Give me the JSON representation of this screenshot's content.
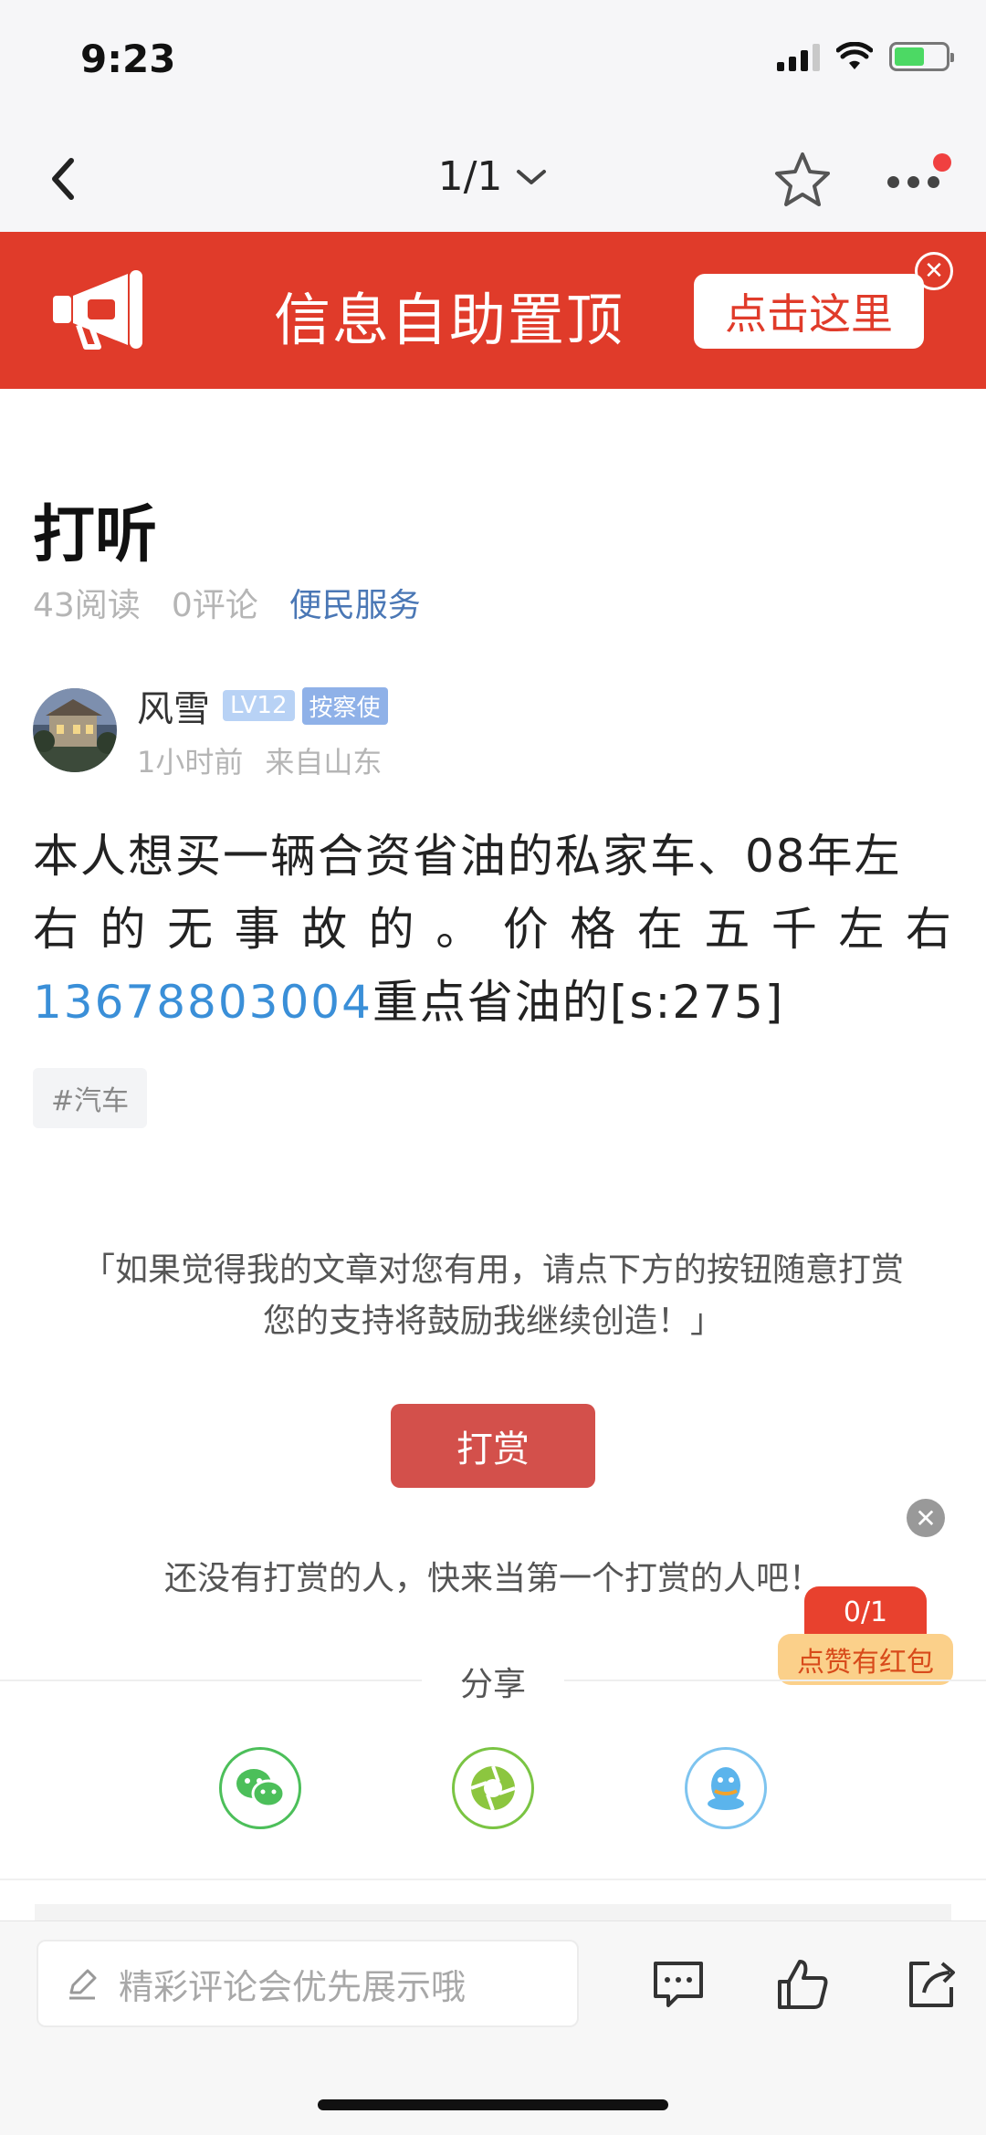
{
  "status_bar": {
    "time": "9:23"
  },
  "nav": {
    "page_indicator": "1/1"
  },
  "banner": {
    "text": "信息自助置顶",
    "button_label": "点击这里",
    "close_symbol": "✕"
  },
  "article": {
    "title": "打听",
    "reads": "43阅读",
    "comments": "0评论",
    "category": "便民服务",
    "author": {
      "name": "风雪",
      "level": "LV12",
      "role": "按察使",
      "time": "1小时前",
      "location": "来自山东"
    },
    "body": {
      "line1": "本人想买一辆合资省油的私家车、08年左",
      "line2_chars": [
        "右",
        "的",
        "无",
        "事",
        "故",
        "的",
        "。",
        "价",
        "格",
        "在",
        "五",
        "千",
        "左",
        "右"
      ],
      "phone": "13678803004",
      "line3_rest": "重点省油的[s:275]"
    },
    "tag": "#汽车"
  },
  "reward": {
    "quote_line1": "「如果觉得我的文章对您有用，请点下方的按钮随意打赏",
    "quote_line2": "您的支持将鼓励我继续创造！」",
    "button_label": "打赏",
    "empty_text": "还没有打赏的人，快来当第一个打赏的人吧！"
  },
  "redpack": {
    "count": "0/1",
    "label": "点赞有红包",
    "close_symbol": "✕"
  },
  "share": {
    "title": "分享",
    "icons": [
      "wechat-icon",
      "moments-icon",
      "qq-icon"
    ]
  },
  "bottom_bar": {
    "comment_placeholder": "精彩评论会优先展示哦"
  },
  "colors": {
    "brand_red": "#e03b2a",
    "link_blue": "#3a8fd8",
    "category_blue": "#4a77b5",
    "reward_red": "#d3504b"
  }
}
